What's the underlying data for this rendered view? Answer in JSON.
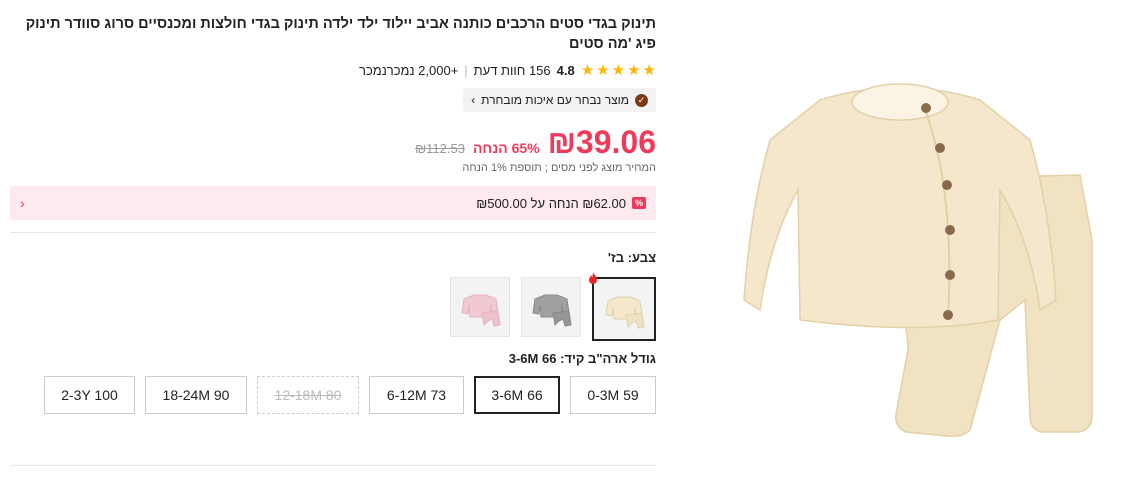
{
  "product": {
    "title": "תינוק בגדי סטים הרכבים כותנה אביב יילוד ילד ילדה תינוק בגדי חולצות ומכנסיים סרוג סוודר תינוק פיג 'מה סטים",
    "rating": "4.8",
    "reviews": "156 חוות דעת",
    "sold": "+2,000 נמכרנמכר",
    "quality_badge": "מוצר נבחר עם איכות מובחרת"
  },
  "price": {
    "current": "₪39.06",
    "discount": "65% הנחה",
    "original": "₪112.53",
    "tax_note": "המחיר מוצג לפני מסים ; תוספת 1% הנחה"
  },
  "promo": {
    "tag": "%",
    "text": "₪62.00 הנחה על ₪500.00",
    "arrow": "‹"
  },
  "color": {
    "label": "צבע: בז'",
    "options": [
      "בז'",
      "אפור",
      "ורוד"
    ]
  },
  "size": {
    "label": "גודל ארה\"ב קיד: 3-6M 66",
    "options": [
      "0-3M 59",
      "3-6M 66",
      "6-12M 73",
      "12-18M 80",
      "18-24M 90",
      "2-3Y 100"
    ],
    "selected": "3-6M 66",
    "unavailable": [
      "12-18M 80"
    ]
  },
  "colors": {
    "price": "#f03a5a",
    "star": "#ffb400",
    "promo_bg": "#fde9ee",
    "beige": "#f3e7cc",
    "grey": "#9b9b9b",
    "pink": "#f1c9d3"
  },
  "icons": {
    "star": "star-icon",
    "quality": "check-badge-icon",
    "chevron": "chevron-right-icon",
    "hot": "fire-icon"
  }
}
